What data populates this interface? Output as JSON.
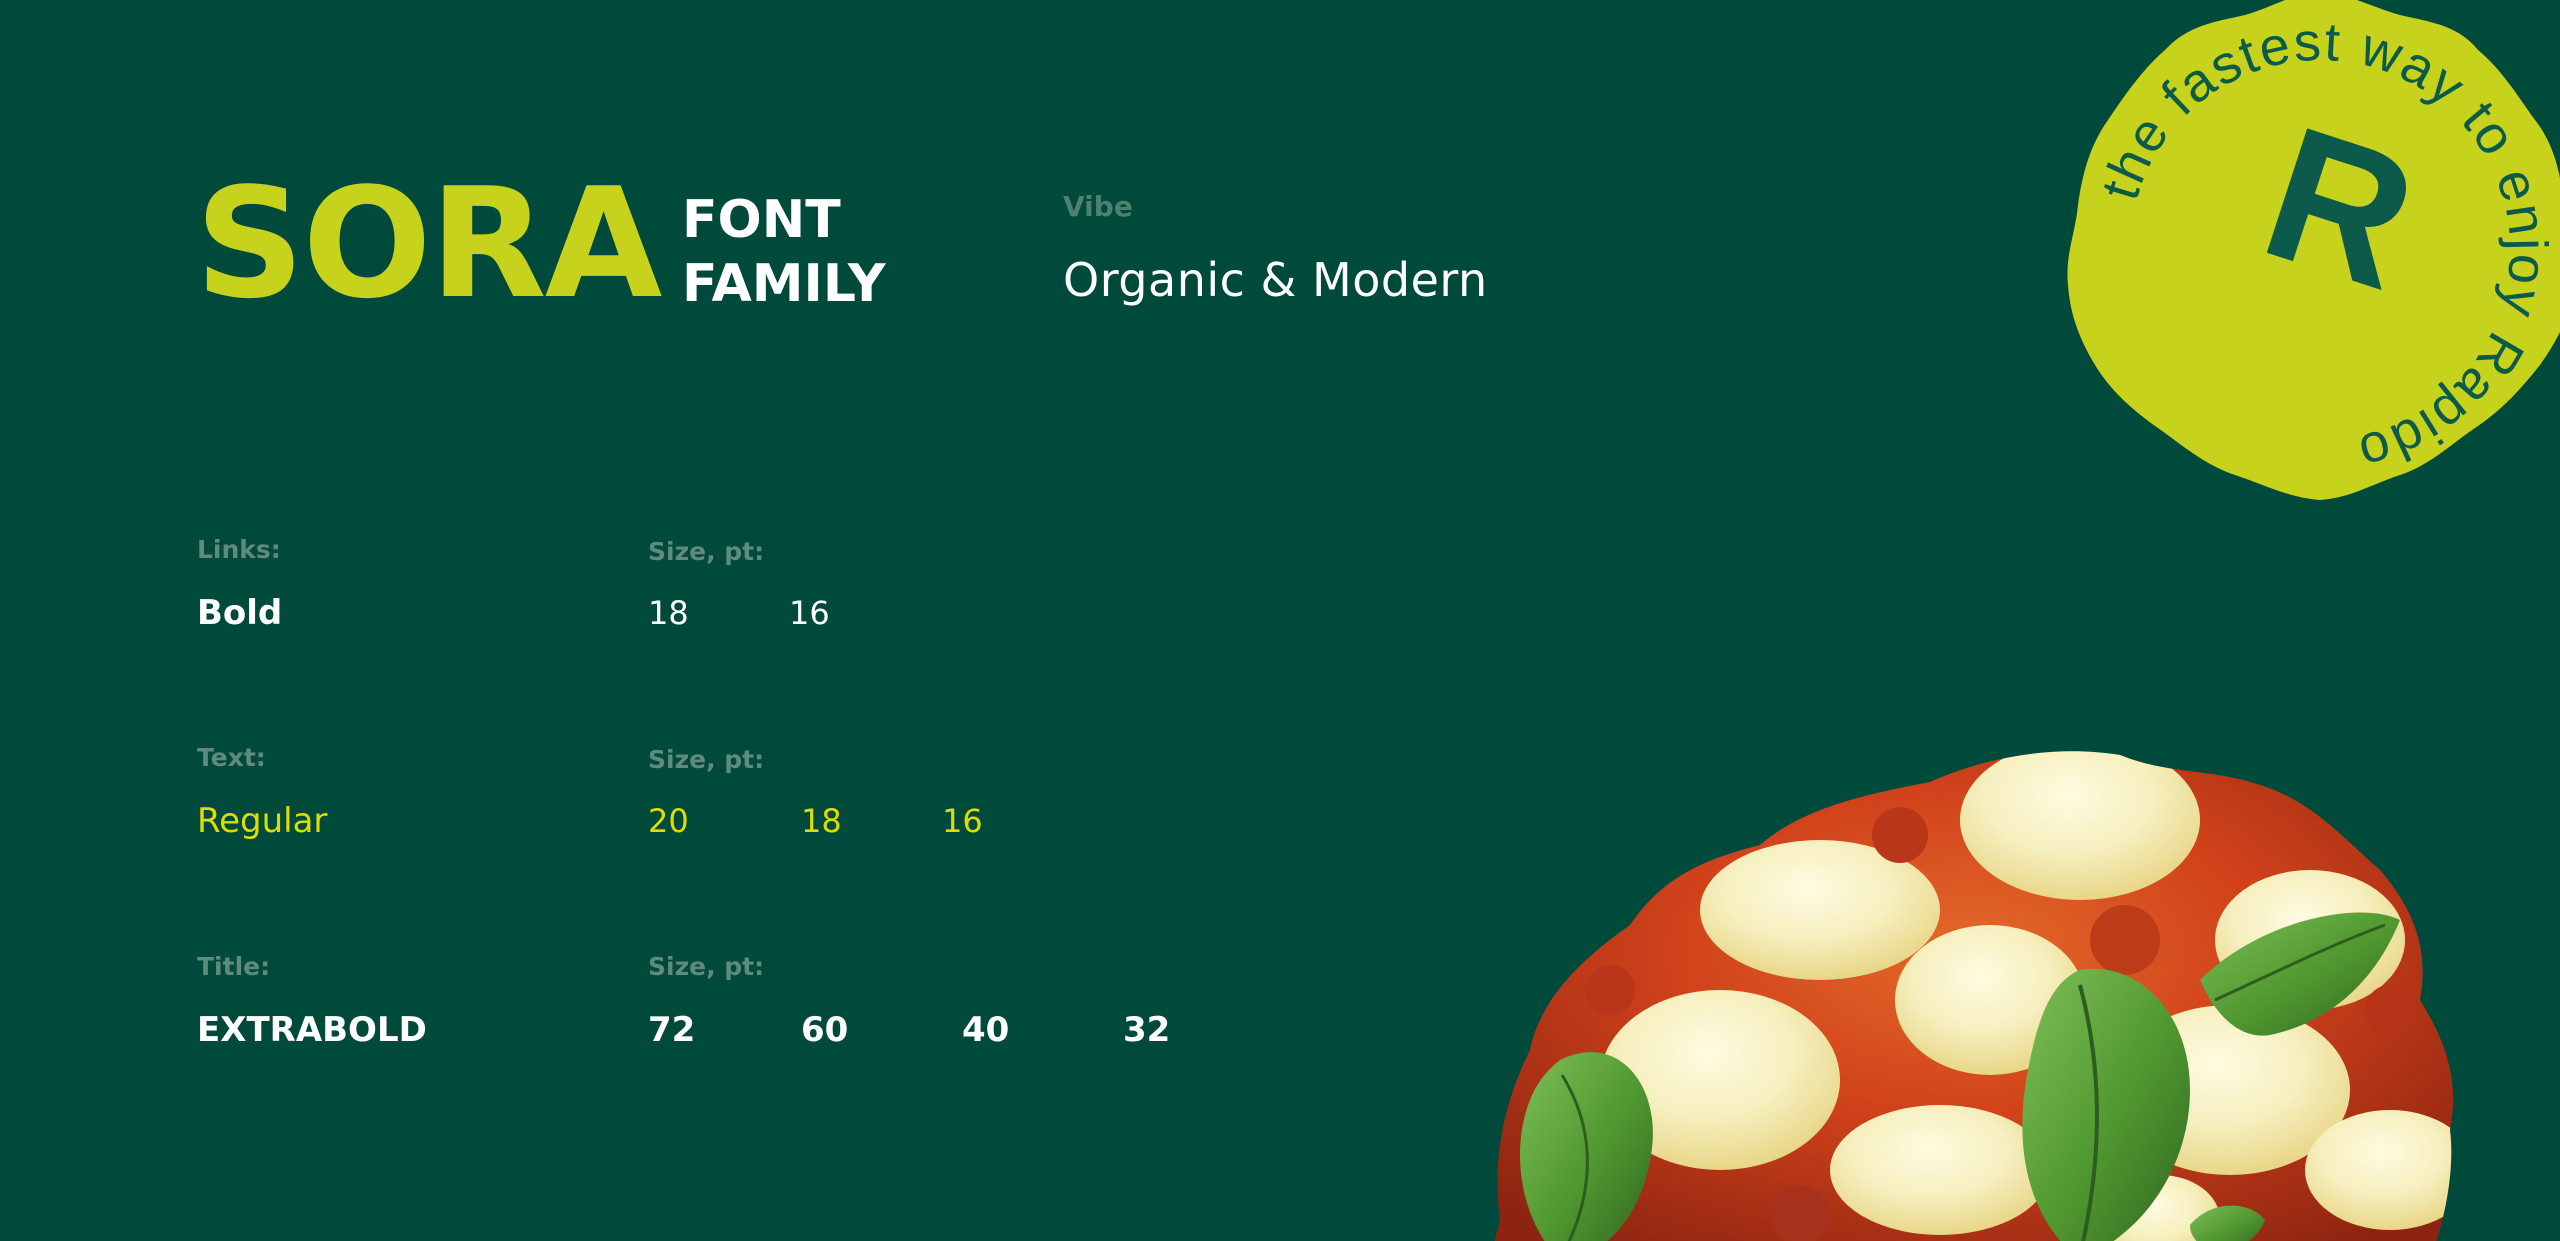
{
  "header": {
    "brand": "SORA",
    "family_line1": "FONT",
    "family_line2": "FAMILY",
    "vibe_label": "Vibe",
    "vibe_value": "Organic & Modern"
  },
  "styles": [
    {
      "label": "Links:",
      "size_label": "Size, pt:",
      "weight": "Bold",
      "sizes": [
        "18",
        "16"
      ]
    },
    {
      "label": "Text:",
      "size_label": "Size, pt:",
      "weight": "Regular",
      "sizes": [
        "20",
        "18",
        "16"
      ]
    },
    {
      "label": "Title:",
      "size_label": "Size, pt:",
      "weight": "EXTRABOLD",
      "sizes": [
        "72",
        "60",
        "40",
        "32"
      ]
    }
  ],
  "badge": {
    "ring_text": "the fastest way to enjoy Rapido ",
    "monogram": "R"
  },
  "colors": {
    "background": "#004a3c",
    "accent": "#c6d21b",
    "text_highlight": "#e0dc00"
  },
  "imagery": {
    "food": "pizza-margherita-image"
  }
}
